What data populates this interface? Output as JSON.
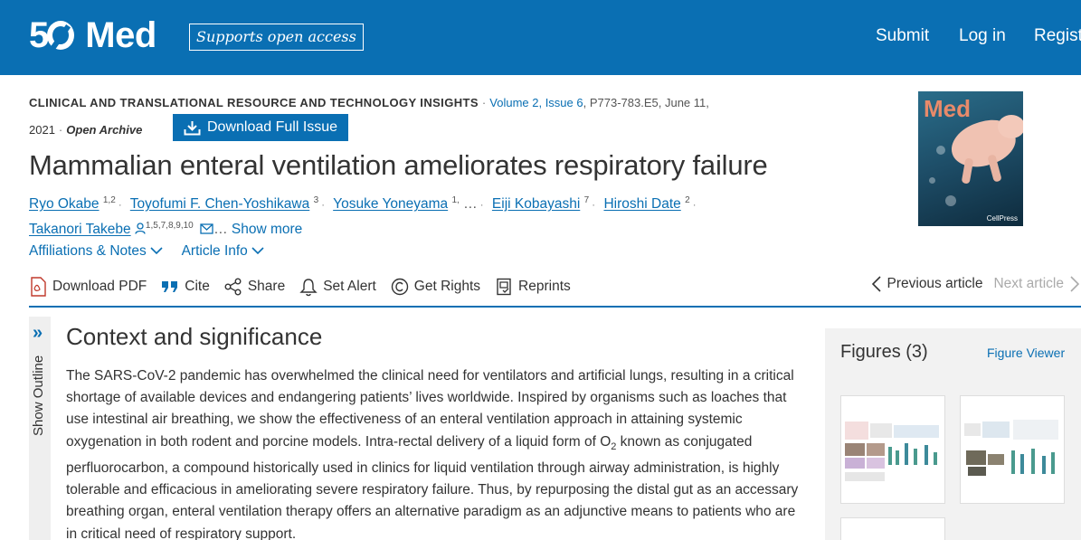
{
  "header": {
    "logo_text": "Med",
    "open_access_badge": "Supports open access",
    "nav": [
      "Submit",
      "Log in",
      "Register"
    ],
    "brand_color": "#0a6fb3"
  },
  "article_meta": {
    "journal_section": "CLINICAL AND TRANSLATIONAL RESOURCE AND TECHNOLOGY INSIGHTS",
    "volume_issue": "Volume 2, Issue 6",
    "pages_date": "P773-783.E5, June 11,",
    "year": "2021",
    "access": "Open Archive",
    "download_issue_label": "Download Full Issue"
  },
  "title": "Mammalian enteral ventilation ameliorates respiratory failure",
  "authors": [
    {
      "name": "Ryo Okabe",
      "sup": "1,2"
    },
    {
      "name": "Toyofumi F. Chen-Yoshikawa",
      "sup": "3"
    },
    {
      "name": "Yosuke Yoneyama",
      "sup": "1,"
    },
    {
      "name": "Eiji Kobayashi",
      "sup": "7"
    },
    {
      "name": "Hiroshi Date",
      "sup": "2"
    },
    {
      "name": "Takanori Takebe",
      "sup": "1,5,7,8,9,10"
    }
  ],
  "ellipsis": "…",
  "show_more": "Show more",
  "info_links": [
    "Affiliations & Notes",
    "Article Info"
  ],
  "toolbar": {
    "download_pdf": "Download PDF",
    "cite": "Cite",
    "share": "Share",
    "set_alert": "Set Alert",
    "get_rights": "Get Rights",
    "reprints": "Reprints",
    "previous": "Previous article",
    "next": "Next article"
  },
  "cover": {
    "title": "Med",
    "publisher": "CellPress"
  },
  "outline": {
    "label": "Show Outline",
    "chevron": "»"
  },
  "context": {
    "heading": "Context and significance",
    "body_pre": "The SARS-CoV-2 pandemic has overwhelmed the clinical need for ventilators and artificial lungs, resulting in a critical shortage of available devices and endangering patients’ lives worldwide. Inspired by organisms such as loaches that use intestinal air breathing, we show the effectiveness of an enteral ventilation approach in attaining systemic oxygenation in both rodent and porcine models. Intra-rectal delivery of a liquid form of O",
    "body_sub": "2",
    "body_post": " known as conjugated perfluorocarbon, a compound historically used in clinics for liquid ventilation through airway administration, is highly tolerable and efficacious in ameliorating severe respiratory failure. Thus, by repurposing the distal gut as an accessary breathing organ, enteral ventilation therapy offers an alternative paradigm as an adjunctive means to patients who are in critical need of respiratory support."
  },
  "figures": {
    "title": "Figures (3)",
    "viewer_link": "Figure Viewer"
  }
}
